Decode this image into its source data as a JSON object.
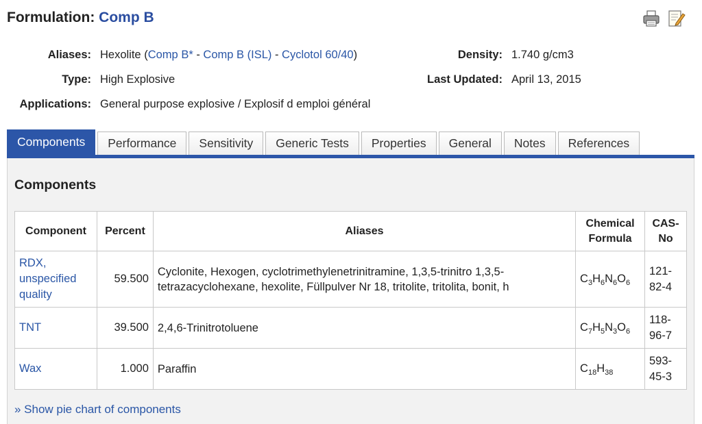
{
  "header": {
    "title_prefix": "Formulation:",
    "title_link": "Comp B",
    "print_icon": "printer-icon",
    "edit_icon": "edit-notepad-icon"
  },
  "meta": {
    "aliases_label": "Aliases:",
    "aliases_text": "Hexolite",
    "alias_links": [
      "Comp B*",
      "Comp B (ISL)",
      "Cyclotol 60/40"
    ],
    "alias_separator": " - ",
    "paren_open": " (",
    "paren_close": ")",
    "type_label": "Type:",
    "type_value": "High Explosive",
    "applications_label": "Applications:",
    "applications_value": "General purpose explosive / Explosif d emploi général",
    "density_label": "Density:",
    "density_value": "1.740 g/cm3",
    "updated_label": "Last Updated:",
    "updated_value": "April 13, 2015"
  },
  "tabs": [
    {
      "label": "Components",
      "active": true
    },
    {
      "label": "Performance"
    },
    {
      "label": "Sensitivity"
    },
    {
      "label": "Generic Tests"
    },
    {
      "label": "Properties"
    },
    {
      "label": "General"
    },
    {
      "label": "Notes"
    },
    {
      "label": "References"
    }
  ],
  "panel": {
    "title": "Components",
    "columns": [
      "Component",
      "Percent",
      "Aliases",
      "Chemical Formula",
      "CAS-No"
    ],
    "rows": [
      {
        "component": "RDX, unspecified quality",
        "percent": "59.500",
        "aliases": "Cyclonite, Hexogen, cyclotrimethylenetrinitramine, 1,3,5-trinitro 1,3,5-tetrazacyclohexane, hexolite, Füllpulver Nr 18, tritolite, tritolita, bonit, h",
        "formula": [
          [
            "C",
            "3"
          ],
          [
            "H",
            "6"
          ],
          [
            "N",
            "6"
          ],
          [
            "O",
            "6"
          ]
        ],
        "cas": "121-82-4"
      },
      {
        "component": "TNT",
        "percent": "39.500",
        "aliases": "2,4,6-Trinitrotoluene",
        "formula": [
          [
            "C",
            "7"
          ],
          [
            "H",
            "5"
          ],
          [
            "N",
            "3"
          ],
          [
            "O",
            "6"
          ]
        ],
        "cas": "118-96-7"
      },
      {
        "component": "Wax",
        "percent": "1.000",
        "aliases": "Paraffin",
        "formula": [
          [
            "C",
            "18"
          ],
          [
            "H",
            "38"
          ]
        ],
        "cas": "593-45-3"
      }
    ],
    "show_chart_link": "» Show pie chart of components"
  }
}
